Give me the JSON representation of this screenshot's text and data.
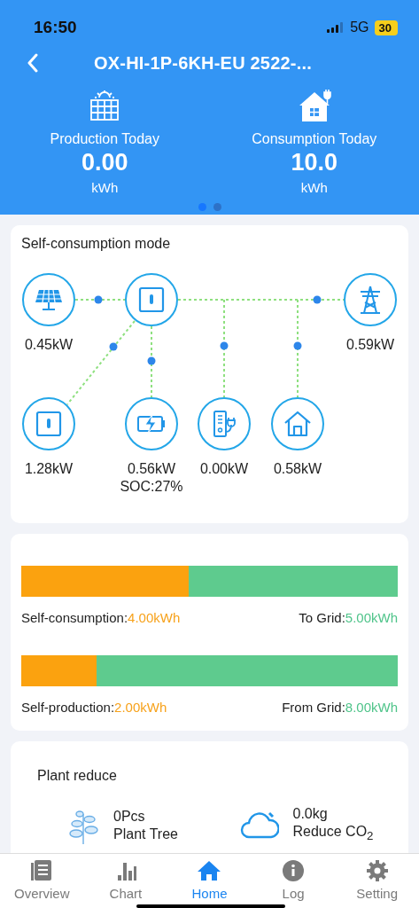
{
  "status_bar": {
    "time": "16:50",
    "network": "5G",
    "battery": "30"
  },
  "header": {
    "title": "OX-HI-1P-6KH-EU 2522-...",
    "stats": [
      {
        "kind": "production",
        "label": "Production Today",
        "value": "0.00",
        "unit": "kWh"
      },
      {
        "kind": "consumption",
        "label": "Consumption Today",
        "value": "10.0",
        "unit": "kWh"
      }
    ],
    "pages": [
      {
        "selected": true
      },
      {
        "selected": false
      }
    ]
  },
  "flow": {
    "title": "Self-consumption mode",
    "nodes": [
      {
        "kind": "solar",
        "reading": "0.45kW"
      },
      {
        "kind": "inverter"
      },
      {
        "kind": "grid",
        "reading": "0.59kW"
      },
      {
        "kind": "backup",
        "reading": "1.28kW"
      },
      {
        "kind": "battery",
        "reading": "0.56kW",
        "soc": "SOC:27%"
      },
      {
        "kind": "charger",
        "reading": "0.00kW"
      },
      {
        "kind": "home",
        "reading": "0.58kW"
      }
    ]
  },
  "energy": {
    "bars": [
      {
        "level": 0.445,
        "left_label": "Self-consumption:",
        "left_value": "4.00kWh",
        "right_label": "To Grid:",
        "right_value": "5.00kWh"
      },
      {
        "level": 0.2,
        "left_label": "Self-production:",
        "left_value": "2.00kWh",
        "right_label": "From Grid:",
        "right_value": "8.00kWh"
      }
    ]
  },
  "plant_reduce": {
    "title": "Plant reduce",
    "items": [
      {
        "kind": "tree",
        "value": "0Pcs",
        "label": "Plant Tree"
      },
      {
        "kind": "co2",
        "value": "0.0kg",
        "label": "Reduce CO$_{2}$"
      }
    ]
  },
  "tabs": [
    {
      "label": "Overview",
      "kind": "overview",
      "selected": false
    },
    {
      "label": "Chart",
      "kind": "chart",
      "selected": false
    },
    {
      "label": "Home",
      "kind": "home",
      "selected": true
    },
    {
      "label": "Log",
      "kind": "log",
      "selected": false
    },
    {
      "label": "Setting",
      "kind": "setting",
      "selected": false
    }
  ]
}
